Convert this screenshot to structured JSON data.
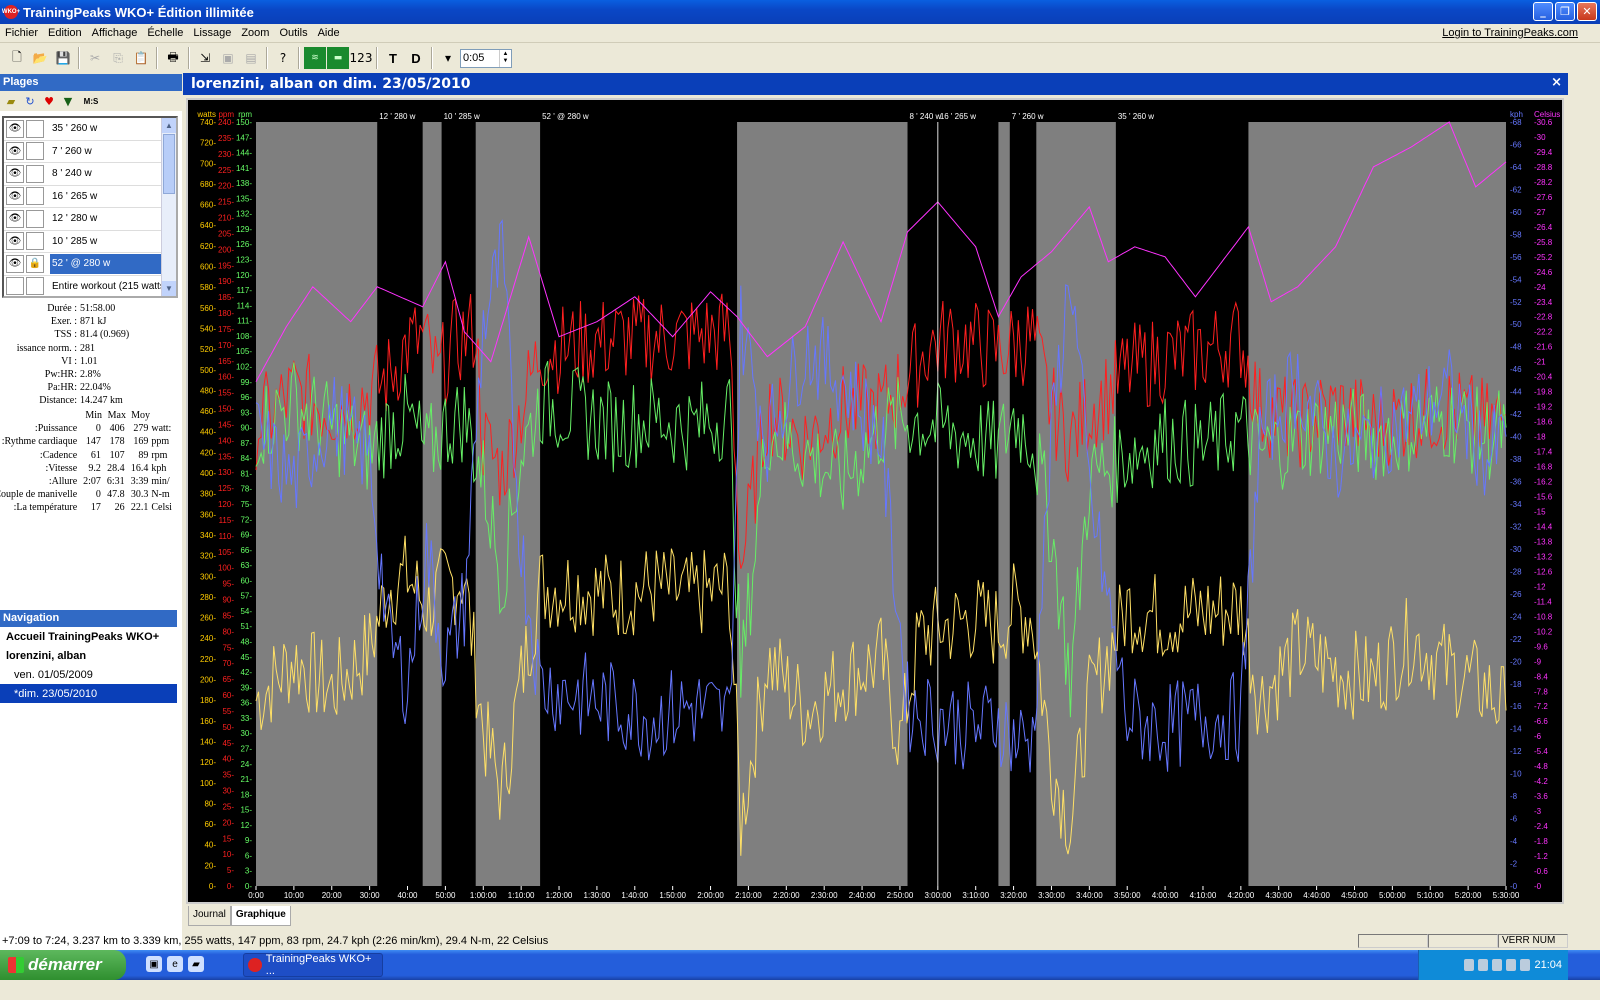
{
  "window": {
    "title": "TrainingPeaks WKO+ Édition illimitée",
    "app_icon_text": "WKO+"
  },
  "menu": {
    "items": [
      "Fichier",
      "Edition",
      "Affichage",
      "Échelle",
      "Lissage",
      "Zoom",
      "Outils",
      "Aide"
    ],
    "active": "Fichier",
    "login_link": "Login to TrainingPeaks.com"
  },
  "toolbar": {
    "smoothing_value": "0:05",
    "t_label": "T",
    "d_label": "D",
    "numbers_label": "123"
  },
  "plages": {
    "header": "Plages",
    "tools_label": "M:S",
    "ranges": [
      {
        "label": "35 ' 260 w",
        "selected": false
      },
      {
        "label": "7 ' 260 w",
        "selected": false
      },
      {
        "label": "8 ' 240 w",
        "selected": false
      },
      {
        "label": "16 ' 265 w",
        "selected": false
      },
      {
        "label": "12 ' 280 w",
        "selected": false
      },
      {
        "label": "10 ' 285 w",
        "selected": false
      },
      {
        "label": "52 ' @ 280 w",
        "selected": true
      },
      {
        "label": "Entire workout (215 watts",
        "selected": false
      }
    ]
  },
  "stats": [
    {
      "k": "Durée :",
      "v": "51:58.00"
    },
    {
      "k": "Exer. :",
      "v": "871 kJ"
    },
    {
      "k": "TSS :",
      "v": "81.4 (0.969)"
    },
    {
      "k": "issance norm. :",
      "v": "281"
    },
    {
      "k": "VI :",
      "v": "1.01"
    },
    {
      "k": "Pw:HR:",
      "v": "2.8%"
    },
    {
      "k": "Pa:HR:",
      "v": "22.04%"
    },
    {
      "k": "Distance:",
      "v": "14.247 km"
    }
  ],
  "minmax": {
    "headers": [
      "Min",
      "Max",
      "Moy"
    ],
    "rows": [
      {
        "k": "Puissance:",
        "min": "0",
        "max": "406",
        "avg": "279",
        "u": "watt:"
      },
      {
        "k": "Rythme cardiaque:",
        "min": "147",
        "max": "178",
        "avg": "169",
        "u": "ppm"
      },
      {
        "k": "Cadence:",
        "min": "61",
        "max": "107",
        "avg": "89",
        "u": "rpm"
      },
      {
        "k": "Vitesse:",
        "min": "9.2",
        "max": "28.4",
        "avg": "16.4",
        "u": "kph"
      },
      {
        "k": "Allure:",
        "min": "2:07",
        "max": "6:31",
        "avg": "3:39",
        "u": "min/"
      },
      {
        "k": "Couple de manivelle:",
        "min": "0",
        "max": "47.8",
        "avg": "30.3",
        "u": "N-m"
      },
      {
        "k": "La température:",
        "min": "17",
        "max": "26",
        "avg": "22.1",
        "u": "Celsi"
      }
    ]
  },
  "navigation": {
    "header": "Navigation",
    "items": [
      {
        "label": "Accueil TrainingPeaks WKO+",
        "bold": true,
        "indent": false,
        "selected": false
      },
      {
        "label": "lorenzini, alban",
        "bold": true,
        "indent": false,
        "selected": false
      },
      {
        "label": "ven. 01/05/2009",
        "bold": false,
        "indent": true,
        "selected": false
      },
      {
        "label": "*dim. 23/05/2010",
        "bold": false,
        "indent": true,
        "selected": true
      }
    ]
  },
  "document": {
    "title": "lorenzini, alban on dim. 23/05/2010",
    "close": "×"
  },
  "tabs": [
    {
      "label": "Journal",
      "active": false
    },
    {
      "label": "Graphique",
      "active": true
    }
  ],
  "status": {
    "text": "+7:09 to 7:24, 3.237 km to 3.339 km, 255 watts, 147 ppm, 83 rpm, 24.7 kph (2:26 min/km), 29.4 N-m, 22 Celsius",
    "panels": [
      "",
      "",
      "VERR NUM"
    ]
  },
  "taskbar": {
    "start": "démarrer",
    "task": "TrainingPeaks WKO+ ...",
    "clock": "21:04"
  },
  "chart_data": {
    "type": "line",
    "xlabel": "",
    "x_ticks": [
      "0:00",
      "10:00",
      "20:00",
      "30:00",
      "40:00",
      "50:00",
      "1:00:00",
      "1:10:00",
      "1:20:00",
      "1:30:00",
      "1:40:00",
      "1:50:00",
      "2:00:00",
      "2:10:00",
      "2:20:00",
      "2:30:00",
      "2:40:00",
      "2:50:00",
      "3:00:00",
      "3:10:00",
      "3:20:00",
      "3:30:00",
      "3:40:00",
      "3:50:00",
      "4:00:00",
      "4:10:00",
      "4:20:00",
      "4:30:00",
      "4:40:00",
      "4:50:00",
      "5:00:00",
      "5:10:00",
      "5:20:00",
      "5:30:00"
    ],
    "xlim_minutes": [
      0,
      330
    ],
    "axes": {
      "watts": {
        "label": "watts",
        "min": 0,
        "max": 740,
        "step": 20,
        "color": "#ffcc00"
      },
      "ppm": {
        "label": "ppm",
        "min": 0,
        "max": 240,
        "step": 5,
        "color": "#ff2020"
      },
      "rpm": {
        "label": "rpm",
        "min": 0,
        "max": 150,
        "step": 3,
        "color": "#66ff66"
      },
      "kph": {
        "label": "kph",
        "min": 0,
        "max": 68,
        "step": 2,
        "color": "#6677ff"
      },
      "celsius": {
        "label": "Celsius",
        "min": 0,
        "max": 30.6,
        "step": 0.6,
        "color": "#ff33ff"
      }
    },
    "intervals": [
      {
        "label": "12 ' 280 w",
        "start": 32,
        "end": 44
      },
      {
        "label": "10 ' 285 w",
        "start": 49,
        "end": 58
      },
      {
        "label": "52 ' @ 280 w",
        "start": 75,
        "end": 127
      },
      {
        "label": "8 ' 240 w",
        "start": 172,
        "end": 180
      },
      {
        "label": "16 ' 265 w",
        "start": 180,
        "end": 196
      },
      {
        "label": "7 ' 260 w",
        "start": 199,
        "end": 206
      },
      {
        "label": "35 ' 260 w",
        "start": 227,
        "end": 262
      }
    ],
    "series": [
      {
        "name": "Puissance",
        "axis": "watts",
        "color": "#ffe066",
        "points": [
          [
            0,
            180
          ],
          [
            10,
            220
          ],
          [
            20,
            190
          ],
          [
            30,
            230
          ],
          [
            35,
            290
          ],
          [
            40,
            300
          ],
          [
            45,
            270
          ],
          [
            50,
            290
          ],
          [
            55,
            300
          ],
          [
            60,
            150
          ],
          [
            65,
            90
          ],
          [
            70,
            200
          ],
          [
            75,
            290
          ],
          [
            85,
            290
          ],
          [
            95,
            280
          ],
          [
            105,
            290
          ],
          [
            115,
            280
          ],
          [
            125,
            290
          ],
          [
            128,
            60
          ],
          [
            135,
            220
          ],
          [
            145,
            170
          ],
          [
            155,
            200
          ],
          [
            165,
            220
          ],
          [
            170,
            140
          ],
          [
            175,
            240
          ],
          [
            180,
            250
          ],
          [
            190,
            260
          ],
          [
            196,
            250
          ],
          [
            200,
            270
          ],
          [
            205,
            260
          ],
          [
            210,
            120
          ],
          [
            215,
            60
          ],
          [
            220,
            180
          ],
          [
            230,
            270
          ],
          [
            240,
            260
          ],
          [
            250,
            265
          ],
          [
            260,
            270
          ],
          [
            265,
            180
          ],
          [
            275,
            230
          ],
          [
            285,
            210
          ],
          [
            295,
            200
          ],
          [
            305,
            240
          ],
          [
            315,
            210
          ],
          [
            325,
            190
          ],
          [
            330,
            170
          ]
        ]
      },
      {
        "name": "Rythme cardiaque",
        "axis": "ppm",
        "color": "#ff2020",
        "points": [
          [
            0,
            145
          ],
          [
            10,
            155
          ],
          [
            20,
            150
          ],
          [
            30,
            155
          ],
          [
            35,
            160
          ],
          [
            40,
            170
          ],
          [
            44,
            172
          ],
          [
            48,
            160
          ],
          [
            52,
            170
          ],
          [
            58,
            175
          ],
          [
            60,
            140
          ],
          [
            65,
            130
          ],
          [
            70,
            150
          ],
          [
            75,
            168
          ],
          [
            85,
            170
          ],
          [
            95,
            172
          ],
          [
            105,
            172
          ],
          [
            115,
            173
          ],
          [
            125,
            174
          ],
          [
            128,
            100
          ],
          [
            135,
            150
          ],
          [
            145,
            140
          ],
          [
            155,
            150
          ],
          [
            165,
            150
          ],
          [
            172,
            160
          ],
          [
            178,
            170
          ],
          [
            184,
            172
          ],
          [
            190,
            170
          ],
          [
            196,
            168
          ],
          [
            200,
            170
          ],
          [
            205,
            172
          ],
          [
            210,
            150
          ],
          [
            215,
            140
          ],
          [
            220,
            150
          ],
          [
            225,
            155
          ],
          [
            230,
            162
          ],
          [
            240,
            166
          ],
          [
            250,
            168
          ],
          [
            260,
            172
          ],
          [
            265,
            150
          ],
          [
            275,
            145
          ],
          [
            285,
            150
          ],
          [
            295,
            145
          ],
          [
            305,
            148
          ],
          [
            315,
            150
          ],
          [
            325,
            145
          ],
          [
            330,
            148
          ]
        ]
      },
      {
        "name": "Cadence",
        "axis": "rpm",
        "color": "#66ee66",
        "points": [
          [
            0,
            90
          ],
          [
            10,
            95
          ],
          [
            20,
            90
          ],
          [
            30,
            85
          ],
          [
            35,
            90
          ],
          [
            40,
            92
          ],
          [
            45,
            85
          ],
          [
            50,
            90
          ],
          [
            55,
            92
          ],
          [
            60,
            80
          ],
          [
            65,
            60
          ],
          [
            70,
            85
          ],
          [
            75,
            95
          ],
          [
            85,
            93
          ],
          [
            95,
            90
          ],
          [
            105,
            92
          ],
          [
            115,
            90
          ],
          [
            125,
            93
          ],
          [
            128,
            40
          ],
          [
            135,
            90
          ],
          [
            145,
            85
          ],
          [
            155,
            80
          ],
          [
            165,
            90
          ],
          [
            172,
            92
          ],
          [
            180,
            90
          ],
          [
            190,
            88
          ],
          [
            196,
            86
          ],
          [
            200,
            92
          ],
          [
            205,
            88
          ],
          [
            210,
            70
          ],
          [
            215,
            40
          ],
          [
            220,
            80
          ],
          [
            230,
            85
          ],
          [
            240,
            88
          ],
          [
            250,
            86
          ],
          [
            260,
            90
          ],
          [
            265,
            85
          ],
          [
            275,
            88
          ],
          [
            285,
            90
          ],
          [
            295,
            88
          ],
          [
            305,
            90
          ],
          [
            315,
            92
          ],
          [
            325,
            88
          ],
          [
            330,
            90
          ]
        ]
      },
      {
        "name": "Vitesse",
        "axis": "kph",
        "color": "#6677ff",
        "points": [
          [
            0,
            40
          ],
          [
            10,
            36
          ],
          [
            20,
            42
          ],
          [
            30,
            38
          ],
          [
            35,
            22
          ],
          [
            40,
            18
          ],
          [
            45,
            30
          ],
          [
            50,
            20
          ],
          [
            55,
            25
          ],
          [
            60,
            50
          ],
          [
            65,
            56
          ],
          [
            70,
            30
          ],
          [
            75,
            18
          ],
          [
            85,
            17
          ],
          [
            95,
            16
          ],
          [
            105,
            15
          ],
          [
            115,
            16
          ],
          [
            125,
            15
          ],
          [
            128,
            50
          ],
          [
            135,
            40
          ],
          [
            145,
            48
          ],
          [
            155,
            45
          ],
          [
            165,
            40
          ],
          [
            172,
            16
          ],
          [
            180,
            15
          ],
          [
            190,
            14
          ],
          [
            196,
            15
          ],
          [
            200,
            13
          ],
          [
            205,
            13
          ],
          [
            210,
            40
          ],
          [
            215,
            55
          ],
          [
            220,
            35
          ],
          [
            230,
            15
          ],
          [
            240,
            14
          ],
          [
            250,
            15
          ],
          [
            260,
            15
          ],
          [
            265,
            40
          ],
          [
            275,
            45
          ],
          [
            285,
            38
          ],
          [
            295,
            40
          ],
          [
            305,
            42
          ],
          [
            315,
            44
          ],
          [
            325,
            38
          ],
          [
            330,
            40
          ]
        ]
      },
      {
        "name": "La température",
        "axis": "celsius",
        "color": "#ff33ff",
        "points": [
          [
            0,
            20.2
          ],
          [
            8,
            22.4
          ],
          [
            15,
            24.0
          ],
          [
            25,
            22.6
          ],
          [
            32,
            24.0
          ],
          [
            44,
            23.2
          ],
          [
            50,
            25.0
          ],
          [
            55,
            22.2
          ],
          [
            62,
            21.0
          ],
          [
            72,
            26.0
          ],
          [
            80,
            22.0
          ],
          [
            90,
            22.6
          ],
          [
            100,
            23.6
          ],
          [
            110,
            22.0
          ],
          [
            120,
            23.8
          ],
          [
            127,
            22.8
          ],
          [
            135,
            21.2
          ],
          [
            145,
            22.4
          ],
          [
            155,
            25.8
          ],
          [
            165,
            22.6
          ],
          [
            172,
            26.2
          ],
          [
            180,
            27.4
          ],
          [
            190,
            25.6
          ],
          [
            196,
            22.8
          ],
          [
            202,
            24.4
          ],
          [
            210,
            25.4
          ],
          [
            220,
            27.2
          ],
          [
            225,
            25.0
          ],
          [
            232,
            25.6
          ],
          [
            240,
            25.2
          ],
          [
            248,
            23.6
          ],
          [
            255,
            25.0
          ],
          [
            262,
            26.4
          ],
          [
            268,
            23.4
          ],
          [
            275,
            24.0
          ],
          [
            285,
            25.6
          ],
          [
            295,
            28.8
          ],
          [
            305,
            29.6
          ],
          [
            315,
            30.6
          ],
          [
            322,
            28.0
          ],
          [
            330,
            29.0
          ]
        ]
      }
    ]
  }
}
